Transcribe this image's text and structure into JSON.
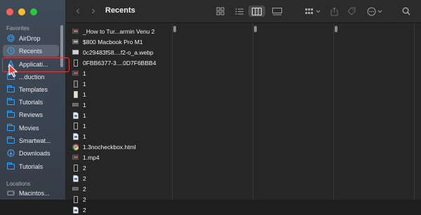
{
  "colors": {
    "close": "#ff5f57",
    "minimize": "#febc2e",
    "zoom": "#28c840",
    "accent": "#36a2f5",
    "highlight": "#e23b3b"
  },
  "window": {
    "title": "Recents"
  },
  "sidebar": {
    "favorites_label": "Favorites",
    "locations_label": "Locations",
    "items": [
      {
        "label": "AirDrop",
        "icon": "airdrop-icon"
      },
      {
        "label": "Recents",
        "icon": "clock-icon",
        "active": true
      },
      {
        "label": "Applicati...",
        "icon": "applications-icon"
      },
      {
        "label": "...duction",
        "icon": "folder-icon"
      },
      {
        "label": "Templates",
        "icon": "folder-icon"
      },
      {
        "label": "Tutorials",
        "icon": "folder-icon"
      },
      {
        "label": "Reviews",
        "icon": "folder-icon"
      },
      {
        "label": "Movies",
        "icon": "folder-icon"
      },
      {
        "label": "Smartwat...",
        "icon": "folder-icon"
      },
      {
        "label": "Downloads",
        "icon": "downloads-icon"
      },
      {
        "label": "Tutorials",
        "icon": "folder-icon"
      }
    ],
    "locations": [
      {
        "label": "Macintos...",
        "icon": "disk-icon"
      }
    ]
  },
  "toolbar": {
    "back": "‹",
    "forward": "›",
    "icons": [
      "grid-view-icon",
      "list-view-icon",
      "column-view-icon",
      "gallery-view-icon",
      "group-icon",
      "share-icon",
      "tag-icon",
      "more-icon",
      "search-icon"
    ]
  },
  "files": [
    {
      "name": "_How to Tur...armin Venu 2",
      "thumb": "video"
    },
    {
      "name": "$800 Macbook Pro M1",
      "thumb": "video"
    },
    {
      "name": "0c29483f58....f2-o_a.webp",
      "thumb": "image"
    },
    {
      "name": "0FBB6377-3....0D7F6BBB4",
      "thumb": "phone"
    },
    {
      "name": "1",
      "thumb": "video"
    },
    {
      "name": "1",
      "thumb": "phone"
    },
    {
      "name": "1",
      "thumb": "phone-light"
    },
    {
      "name": "1",
      "thumb": "wide"
    },
    {
      "name": "1",
      "thumb": "doc"
    },
    {
      "name": "1",
      "thumb": "phone"
    },
    {
      "name": "1",
      "thumb": "doc"
    },
    {
      "name": "1.3nocheckbox.html",
      "thumb": "chrome"
    },
    {
      "name": "1.mp4",
      "thumb": "video"
    },
    {
      "name": "2",
      "thumb": "phone"
    },
    {
      "name": "2",
      "thumb": "doc"
    },
    {
      "name": "2",
      "thumb": "wide"
    },
    {
      "name": "2",
      "thumb": "phone"
    },
    {
      "name": "2",
      "thumb": "doc"
    }
  ]
}
